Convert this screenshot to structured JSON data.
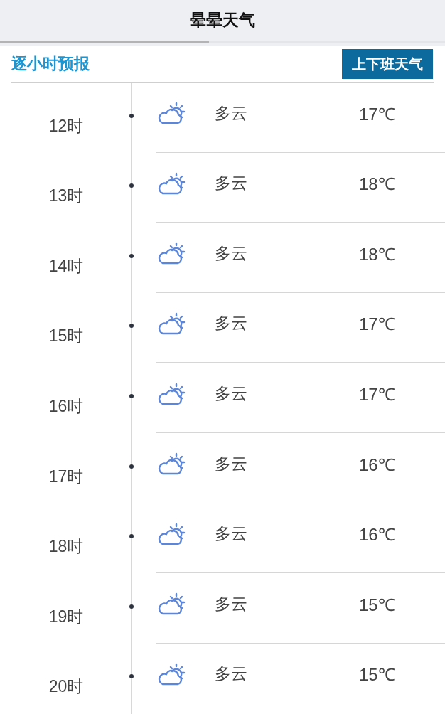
{
  "window": {
    "title": "晕晕天气"
  },
  "header": {
    "title": "逐小时预报",
    "button": "上下班天气"
  },
  "hours": [
    {
      "time": "12时",
      "condition": "多云",
      "temp": "17℃"
    },
    {
      "time": "13时",
      "condition": "多云",
      "temp": "18℃"
    },
    {
      "time": "14时",
      "condition": "多云",
      "temp": "18℃"
    },
    {
      "time": "15时",
      "condition": "多云",
      "temp": "17℃"
    },
    {
      "time": "16时",
      "condition": "多云",
      "temp": "17℃"
    },
    {
      "time": "17时",
      "condition": "多云",
      "temp": "16℃"
    },
    {
      "time": "18时",
      "condition": "多云",
      "temp": "16℃"
    },
    {
      "time": "19时",
      "condition": "多云",
      "temp": "15℃"
    },
    {
      "time": "20时",
      "condition": "多云",
      "temp": "15℃"
    }
  ]
}
